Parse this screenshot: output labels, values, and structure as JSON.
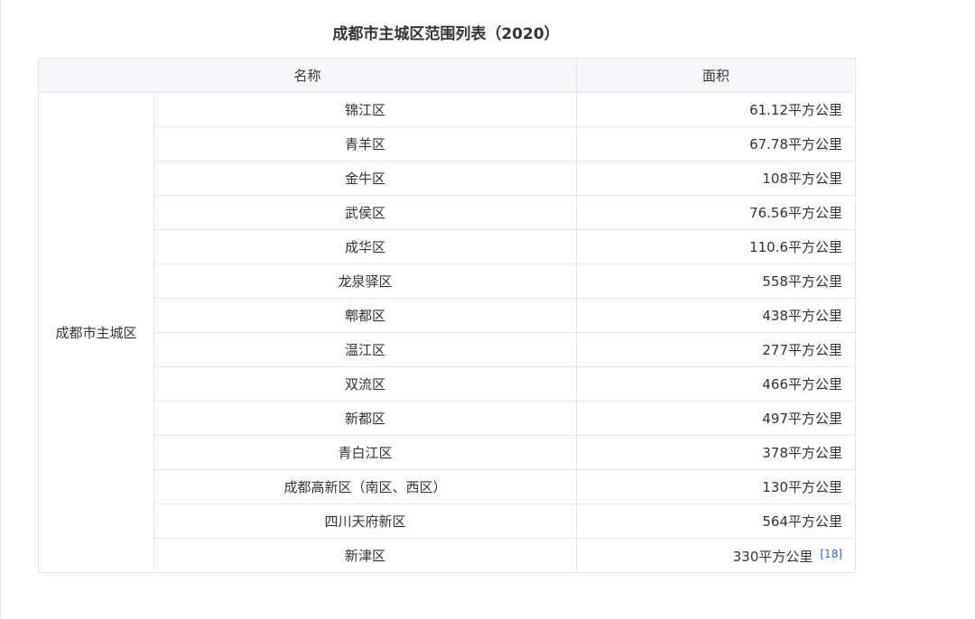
{
  "caption": "成都市主城区范围列表（2020）",
  "headers": {
    "name": "名称",
    "area": "面积"
  },
  "group_label": "成都市主城区",
  "rows": [
    {
      "name": "锦江区",
      "area": "61.12平方公里"
    },
    {
      "name": "青羊区",
      "area": "67.78平方公里"
    },
    {
      "name": "金牛区",
      "area": "108平方公里"
    },
    {
      "name": "武侯区",
      "area": "76.56平方公里"
    },
    {
      "name": "成华区",
      "area": "110.6平方公里"
    },
    {
      "name": "龙泉驿区",
      "area": "558平方公里"
    },
    {
      "name": "郫都区",
      "area": "438平方公里"
    },
    {
      "name": "温江区",
      "area": "277平方公里"
    },
    {
      "name": "双流区",
      "area": "466平方公里"
    },
    {
      "name": "新都区",
      "area": "497平方公里"
    },
    {
      "name": "青白江区",
      "area": "378平方公里"
    },
    {
      "name": "成都高新区（南区、西区）",
      "area": "130平方公里"
    },
    {
      "name": "四川天府新区",
      "area": "564平方公里"
    },
    {
      "name": "新津区",
      "area": "330平方公里",
      "ref": "[18]"
    }
  ]
}
